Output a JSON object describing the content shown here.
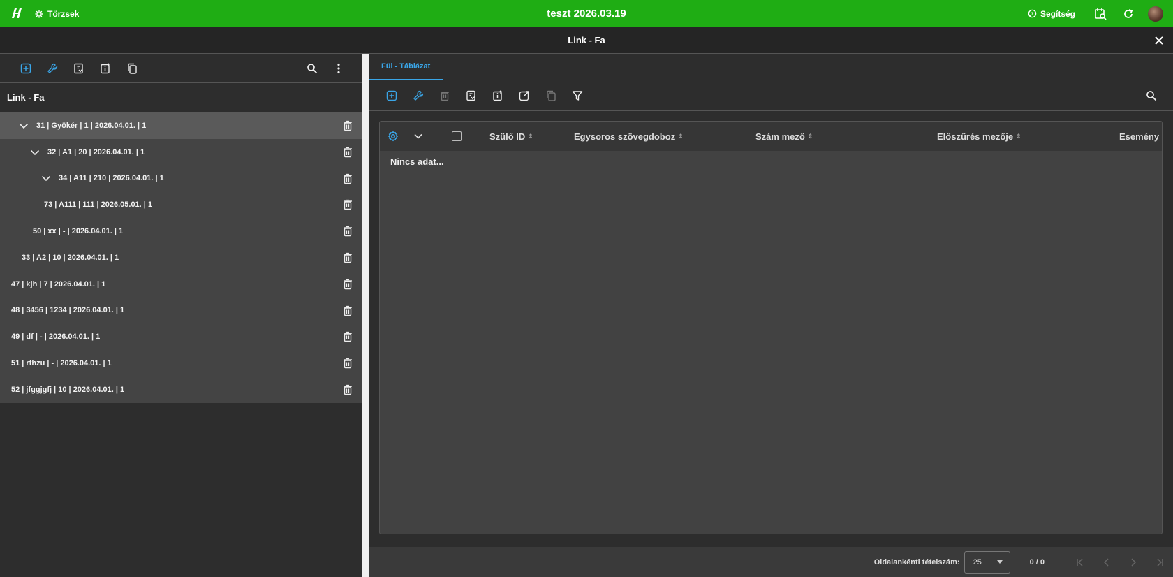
{
  "topbar": {
    "app_title": "teszt 2026.03.19",
    "nav_label": "Törzsek",
    "help_label": "Segítség"
  },
  "window": {
    "title": "Link - Fa"
  },
  "left_panel": {
    "header": "Link - Fa",
    "tree": [
      {
        "label": "31 | Gyökér | 1 | 2026.04.01. | 1",
        "expanded": true,
        "selected": true
      },
      {
        "label": "32 | A1 | 20 | 2026.04.01. | 1",
        "expanded": true
      },
      {
        "label": "34 | A11 | 210 | 2026.04.01. | 1",
        "expanded": true
      },
      {
        "label": "73 | A111 | 111 | 2026.05.01. | 1"
      },
      {
        "label": "50 | xx | - | 2026.04.01. | 1"
      },
      {
        "label": "33 | A2 | 10 | 2026.04.01. | 1"
      },
      {
        "label": "47 | kjh | 7 | 2026.04.01. | 1"
      },
      {
        "label": "48 | 3456 | 1234 | 2026.04.01. | 1"
      },
      {
        "label": "49 | df | - | 2026.04.01. | 1"
      },
      {
        "label": "51 | rthzu | - | 2026.04.01. | 1"
      },
      {
        "label": "52 | jfggjgfj | 10 | 2026.04.01. | 1"
      }
    ]
  },
  "right_panel": {
    "tab_label": "Fül - Táblázat",
    "columns": [
      "Szülő ID",
      "Egysoros szövegdoboz",
      "Szám mező",
      "Előszűrés mezője",
      "Esemény"
    ],
    "empty_text": "Nincs adat...",
    "footer": {
      "per_page_label": "Oldalankénti tételszám:",
      "per_page_value": "25",
      "range": "0 / 0"
    }
  },
  "colors": {
    "accent": "#3aa6e8",
    "topbar": "#1fad14"
  }
}
